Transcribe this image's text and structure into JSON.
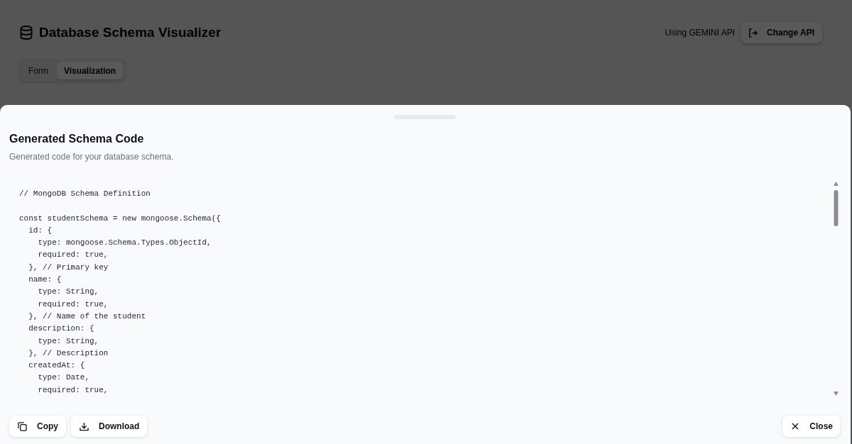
{
  "header": {
    "title": "Database Schema Visualizer",
    "api_status": "Using GEMINI API",
    "change_api_button": "Change API"
  },
  "tabs": [
    {
      "label": "Form",
      "selected": false
    },
    {
      "label": "Visualization",
      "selected": true
    }
  ],
  "drawer": {
    "title": "Generated Schema Code",
    "description": "Generated code for your database schema.",
    "code_sections": [
      [
        "// MongoDB Schema Definition"
      ],
      [
        "const studentSchema = new mongoose.Schema({",
        "  id: {",
        "    type: mongoose.Schema.Types.ObjectId,",
        "    required: true,",
        "  }, // Primary key",
        "  name: {",
        "    type: String,",
        "    required: true,",
        "  }, // Name of the student",
        "  description: {",
        "    type: String,",
        "  }, // Description",
        "  createdAt: {",
        "    type: Date,",
        "    required: true,"
      ]
    ],
    "actions": [
      {
        "label": "Copy",
        "kind": "copy"
      },
      {
        "label": "Download",
        "kind": "download"
      }
    ],
    "close_button": "Close"
  }
}
